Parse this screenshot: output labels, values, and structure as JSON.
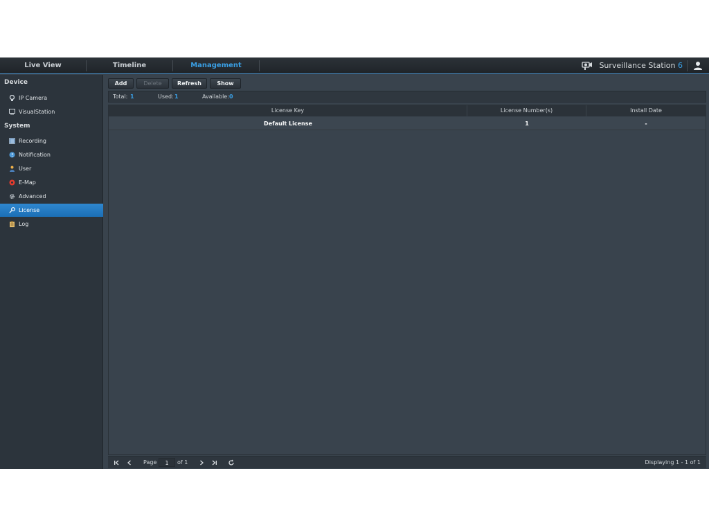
{
  "topbar": {
    "tabs": [
      {
        "label": "Live View"
      },
      {
        "label": "Timeline"
      },
      {
        "label": "Management"
      }
    ],
    "brand_name": "Surveillance Station ",
    "brand_version": "6"
  },
  "sidebar": {
    "groups": [
      {
        "label": "Device",
        "items": [
          {
            "label": "IP Camera"
          },
          {
            "label": "VisualStation"
          }
        ]
      },
      {
        "label": "System",
        "items": [
          {
            "label": "Recording"
          },
          {
            "label": "Notification"
          },
          {
            "label": "User"
          },
          {
            "label": "E-Map"
          },
          {
            "label": "Advanced"
          },
          {
            "label": "License"
          },
          {
            "label": "Log"
          }
        ]
      }
    ]
  },
  "toolbar": {
    "add_label": "Add",
    "delete_label": "Delete",
    "refresh_label": "Refresh",
    "show_label": "Show"
  },
  "summary": {
    "total_label": "Total:",
    "total_value": "1",
    "used_label": "Used:",
    "used_value": "1",
    "available_label": "Available:",
    "available_value": "0"
  },
  "table": {
    "columns": [
      "License Key",
      "License Number(s)",
      "Install Date"
    ],
    "rows": [
      [
        "Default License",
        "1",
        "-"
      ]
    ]
  },
  "pager": {
    "page_label": "Page",
    "page_value": "1",
    "of_label": "of 1",
    "display_text": "Displaying 1 - 1 of 1"
  },
  "colors": {
    "accent": "#3aa0e6",
    "selected": "#1f78c1",
    "panel": "#39434d",
    "sidebar": "#2c343c"
  }
}
